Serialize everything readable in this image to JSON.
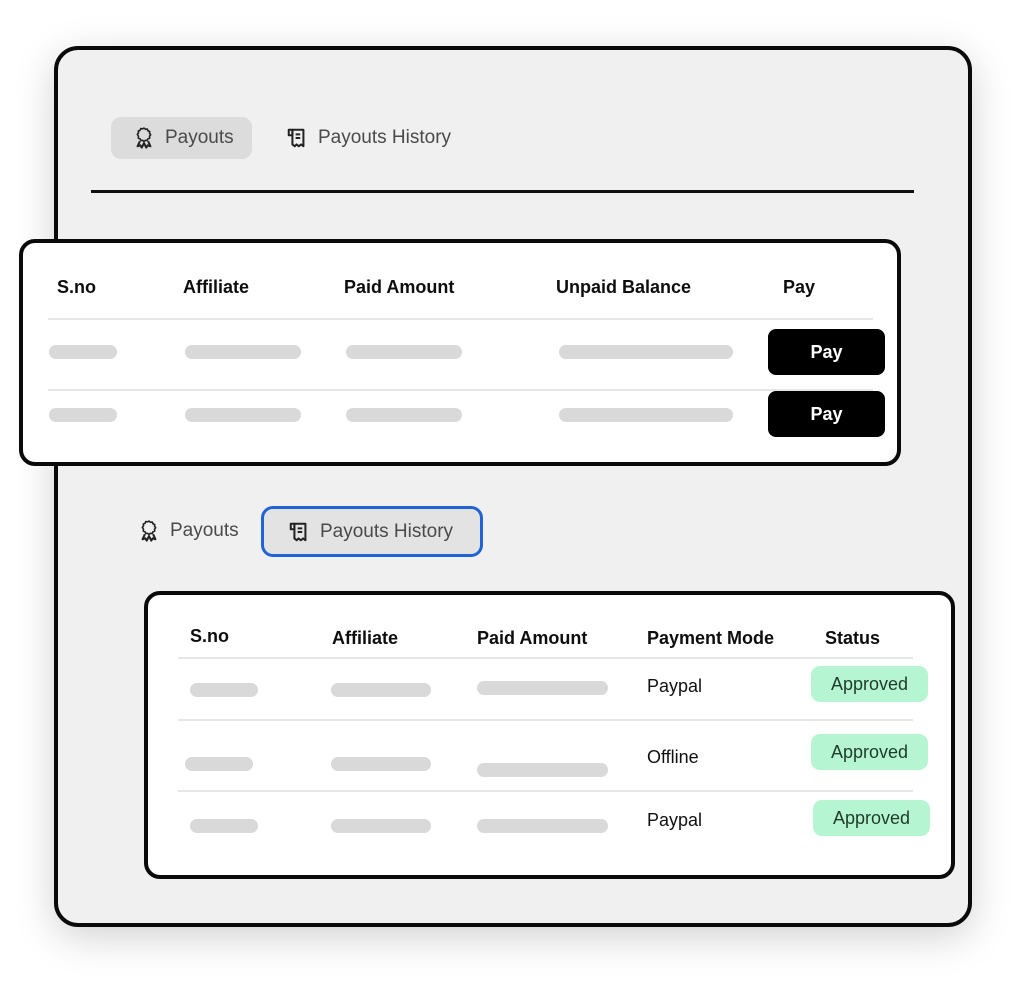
{
  "top_tabs": [
    {
      "label": "Payouts",
      "icon": "award-ribbon-icon",
      "active": true
    },
    {
      "label": "Payouts History",
      "icon": "receipt-icon",
      "active": false
    }
  ],
  "payouts_table": {
    "headers": [
      "S.no",
      "Affiliate",
      "Paid Amount",
      "Unpaid Balance",
      "Pay"
    ],
    "rows": [
      {
        "pay_label": "Pay"
      },
      {
        "pay_label": "Pay"
      }
    ]
  },
  "bottom_tabs": [
    {
      "label": "Payouts",
      "icon": "award-ribbon-icon",
      "active": false
    },
    {
      "label": "Payouts History",
      "icon": "receipt-icon",
      "active": true
    }
  ],
  "history_table": {
    "headers": [
      "S.no",
      "Affiliate",
      "Paid Amount",
      "Payment Mode",
      "Status"
    ],
    "rows": [
      {
        "payment_mode": "Paypal",
        "status": "Approved"
      },
      {
        "payment_mode": "Offline",
        "status": "Approved"
      },
      {
        "payment_mode": "Paypal",
        "status": "Approved"
      }
    ]
  },
  "colors": {
    "active_tab_border": "#1f63d6",
    "status_approved_bg": "#b5f5d2",
    "pay_button_bg": "#000000"
  }
}
